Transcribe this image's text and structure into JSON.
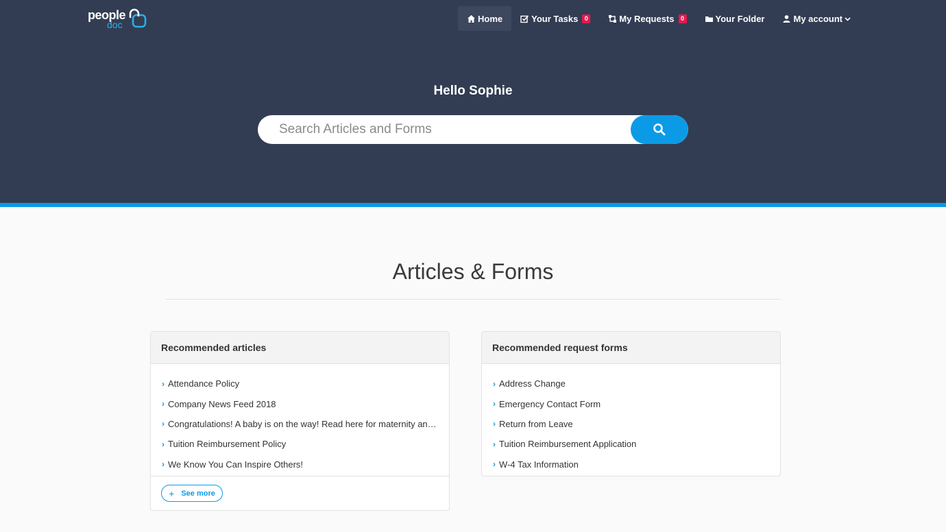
{
  "brand": {
    "name_top": "people",
    "name_sub": "doc"
  },
  "nav": {
    "home": "Home",
    "tasks": "Your Tasks",
    "tasks_count": "0",
    "requests": "My Requests",
    "requests_count": "0",
    "folder": "Your Folder",
    "account": "My account"
  },
  "hero": {
    "greeting": "Hello Sophie",
    "search_placeholder": "Search Articles and Forms"
  },
  "main": {
    "title": "Articles & Forms",
    "articles": {
      "heading": "Recommended articles",
      "items": [
        "Attendance Policy",
        "Company News Feed 2018",
        "Congratulations! A baby is on the way! Read here for maternity and paternity leave",
        "Tuition Reimbursement Policy",
        "We Know You Can Inspire Others!"
      ],
      "see_more": "See more"
    },
    "forms": {
      "heading": "Recommended request forms",
      "items": [
        "Address Change",
        "Emergency Contact Form",
        "Return from Leave",
        "Tuition Reimbursement Application",
        "W-4 Tax Information"
      ]
    }
  },
  "colors": {
    "header_bg": "#323d54",
    "accent": "#0b9be6",
    "badge": "#e8174f",
    "page_bg": "#fafafa"
  },
  "icons": [
    "home-icon",
    "tasks-icon",
    "requests-icon",
    "folder-icon",
    "user-icon",
    "chevron-down-icon",
    "search-icon",
    "plus-icon",
    "chevron-right-icon"
  ]
}
